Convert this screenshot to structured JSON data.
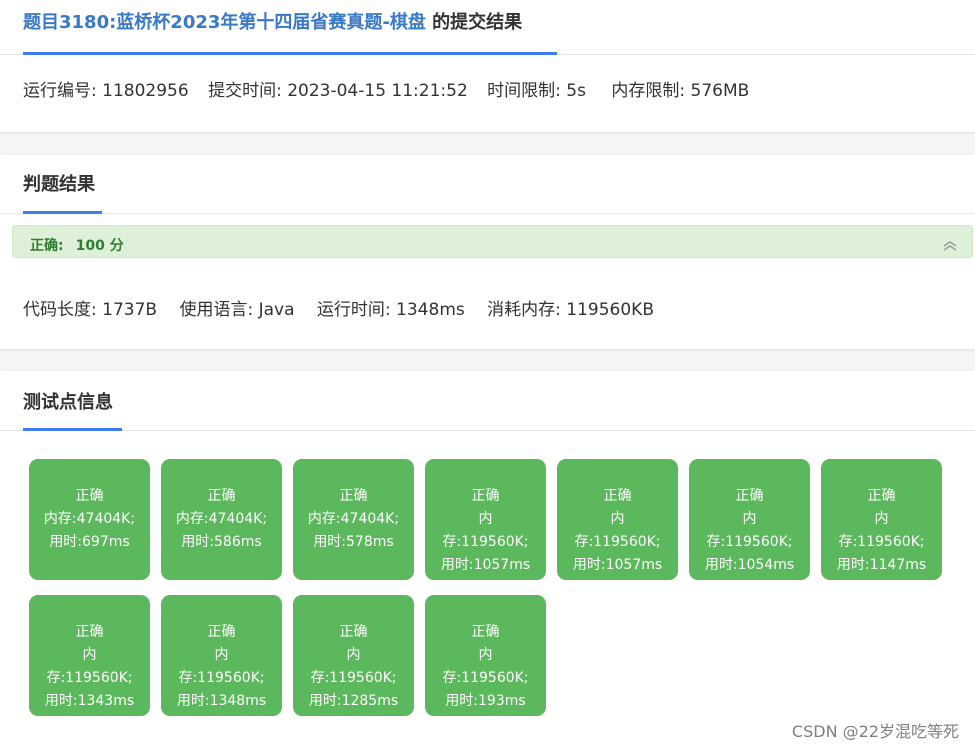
{
  "submission": {
    "title_link": "题目3180:蓝桥杯2023年第十四届省赛真题-棋盘",
    "title_suffix": " 的提交结果",
    "meta": {
      "run_id": "运行编号: 11802956",
      "submit_time": "提交时间: 2023-04-15 11:21:52",
      "time_limit": "时间限制: 5s",
      "memory_limit": "内存限制: 576MB"
    }
  },
  "judge": {
    "title": "判题结果",
    "status_label": "正确:",
    "score": "100 分",
    "collapse_icon": "chevron-double-up-icon",
    "stats": {
      "code_length": "代码长度: 1737B",
      "language": "使用语言: Java",
      "run_time": "运行时间: 1348ms",
      "memory": "消耗内存: 119560KB"
    },
    "banner_color": "#dff0d8"
  },
  "testpoints": {
    "title": "测试点信息",
    "tile_color": "#5cb85c",
    "items": [
      {
        "lines": [
          "正确",
          "内存:47404K;",
          "用时:697ms"
        ]
      },
      {
        "lines": [
          "正确",
          "内存:47404K;",
          "用时:586ms"
        ]
      },
      {
        "lines": [
          "正确",
          "内存:47404K;",
          "用时:578ms"
        ]
      },
      {
        "lines": [
          "正确",
          "内",
          "存:119560K;",
          "用时:1057ms"
        ]
      },
      {
        "lines": [
          "正确",
          "内",
          "存:119560K;",
          "用时:1057ms"
        ]
      },
      {
        "lines": [
          "正确",
          "内",
          "存:119560K;",
          "用时:1054ms"
        ]
      },
      {
        "lines": [
          "正确",
          "内",
          "存:119560K;",
          "用时:1147ms"
        ]
      },
      {
        "lines": [
          "正确",
          "内",
          "存:119560K;",
          "用时:1343ms"
        ]
      },
      {
        "lines": [
          "正确",
          "内",
          "存:119560K;",
          "用时:1348ms"
        ]
      },
      {
        "lines": [
          "正确",
          "内",
          "存:119560K;",
          "用时:1285ms"
        ]
      },
      {
        "lines": [
          "正确",
          "内",
          "存:119560K;",
          "用时:193ms"
        ]
      }
    ]
  },
  "watermark": "CSDN @22岁混吃等死",
  "accent_color": "#3c7df2"
}
